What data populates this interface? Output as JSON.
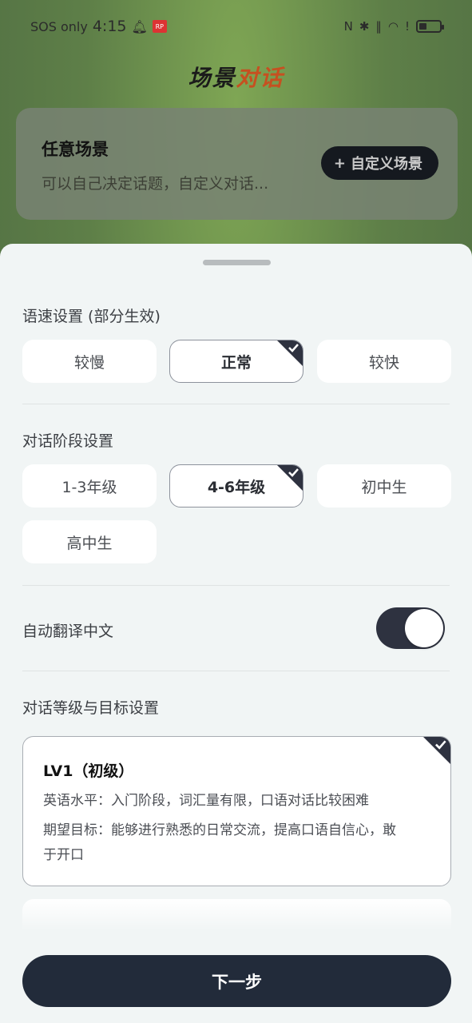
{
  "status_bar": {
    "carrier": "SOS only",
    "time": "4:15",
    "notification_badge": "RP"
  },
  "header": {
    "title_part1": "场景",
    "title_part2": "对话"
  },
  "scene_card": {
    "title": "任意场景",
    "description": "可以自己决定话题，自定义对话...",
    "custom_button": "自定义场景"
  },
  "sheet": {
    "speed": {
      "label": "语速设置 (部分生效)",
      "options": [
        "较慢",
        "正常",
        "较快"
      ],
      "selected": "正常"
    },
    "stage": {
      "label": "对话阶段设置",
      "options": [
        "1-3年级",
        "4-6年级",
        "初中生",
        "高中生"
      ],
      "selected": "4-6年级"
    },
    "translate": {
      "label": "自动翻译中文",
      "enabled": true
    },
    "level": {
      "label": "对话等级与目标设置",
      "card": {
        "title": "LV1（初级）",
        "english_level": "英语水平：入门阶段，词汇量有限，口语对话比较困难",
        "goal_line1": "期望目标：能够进行熟悉的日常交流，提高口语自信心，敢",
        "goal_line2": "于开口"
      }
    },
    "next_button": "下一步"
  },
  "colors": {
    "accent_dark": "#222b3a",
    "title_accent": "#c65020",
    "sheet_bg": "#f1f5f5"
  }
}
